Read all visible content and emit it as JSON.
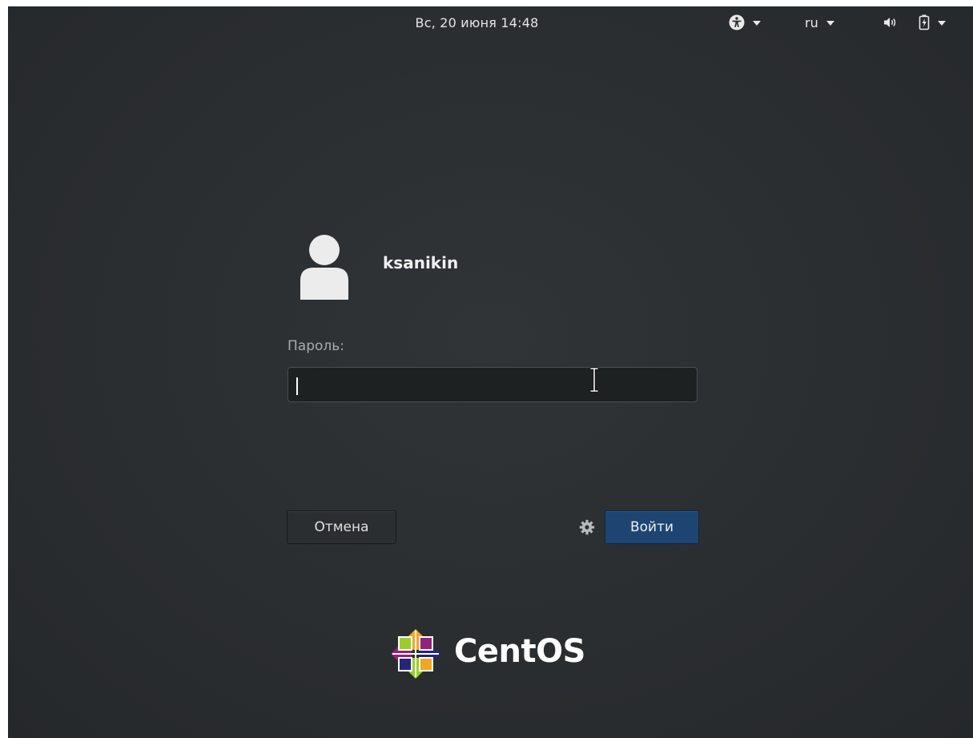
{
  "topbar": {
    "clock": "Вс, 20 июня 14:48",
    "language": "ru",
    "icons": [
      "accessibility-icon",
      "volume-icon",
      "battery-icon",
      "chevron-down-icon"
    ]
  },
  "login": {
    "username": "ksanikin",
    "password_label": "Пароль:",
    "password_value": "",
    "cancel_label": "Отмена",
    "login_label": "Войти"
  },
  "branding": {
    "logo_text": "CentOS"
  },
  "colors": {
    "background": "#2a2d2f",
    "primary_button": "#1e4571",
    "text": "#f0f0f0"
  }
}
